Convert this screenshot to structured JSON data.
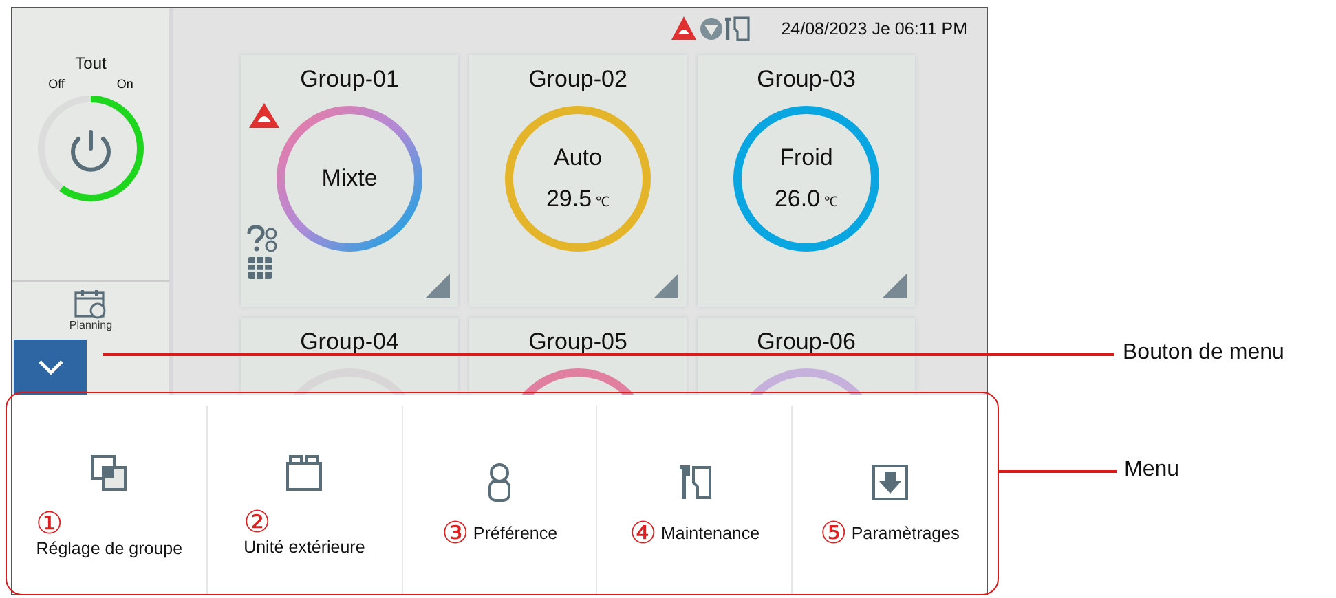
{
  "status_bar": {
    "datetime": "24/08/2023 Je 06:11 PM"
  },
  "all_switch": {
    "title": "Tout",
    "off_label": "Off",
    "on_label": "On",
    "on": true
  },
  "sidebar": {
    "items": [
      {
        "label": "Planning"
      }
    ]
  },
  "groups": [
    {
      "name": "Group-01",
      "kind": "mixed",
      "mode": "Mixte",
      "alarm": true,
      "info_icons": true
    },
    {
      "name": "Group-02",
      "kind": "single",
      "color": "#e4b52a",
      "mode": "Auto",
      "temperature": "29.5",
      "unit": "℃",
      "alarm": false,
      "info_icons": false
    },
    {
      "name": "Group-03",
      "kind": "single",
      "color": "#0aa6e2",
      "mode": "Froid",
      "temperature": "26.0",
      "unit": "℃",
      "alarm": false,
      "info_icons": false
    },
    {
      "name": "Group-04",
      "kind": "single",
      "color": "#d9d6d8",
      "alarm": false,
      "info_icons": false
    },
    {
      "name": "Group-05",
      "kind": "single",
      "color": "#e07fa0",
      "alarm": false,
      "info_icons": false
    },
    {
      "name": "Group-06",
      "kind": "single",
      "color": "#c6b0dc",
      "alarm": false,
      "info_icons": false
    }
  ],
  "menu": {
    "items": [
      {
        "number": "①",
        "label": "Réglage de groupe"
      },
      {
        "number": "②",
        "label": "Unité extérieure"
      },
      {
        "number": "③",
        "label": "Préférence"
      },
      {
        "number": "④",
        "label": "Maintenance"
      },
      {
        "number": "⑤",
        "label": "Paramètrages"
      }
    ]
  },
  "callouts": [
    {
      "label": "Bouton de menu"
    },
    {
      "label": "Menu"
    }
  ]
}
